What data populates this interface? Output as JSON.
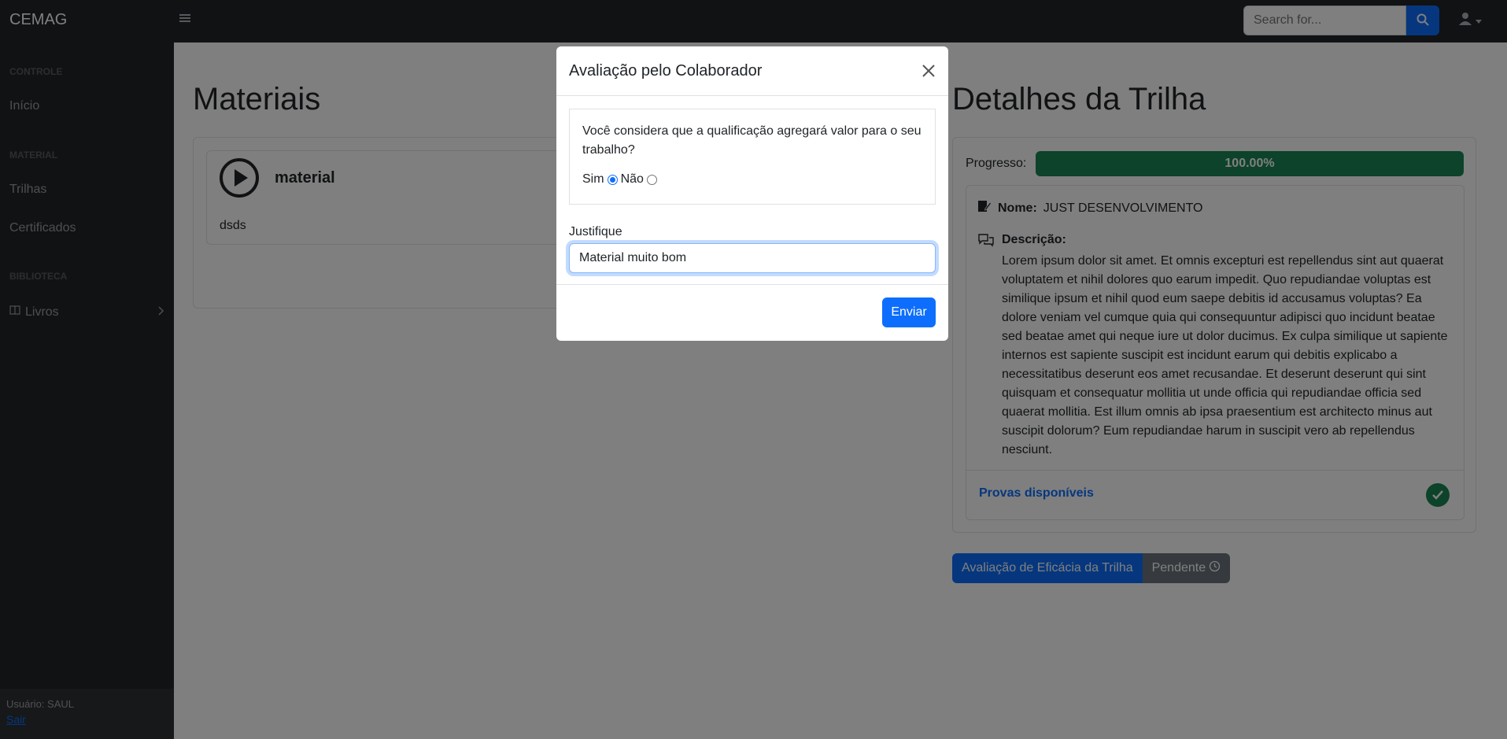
{
  "navbar": {
    "brand": "CEMAG",
    "search_placeholder": "Search for..."
  },
  "sidebar": {
    "sections": [
      {
        "heading": "CONTROLE",
        "items": [
          {
            "label": "Início"
          }
        ]
      },
      {
        "heading": "MATERIAL",
        "items": [
          {
            "label": "Trilhas"
          },
          {
            "label": "Certificados"
          }
        ]
      },
      {
        "heading": "BIBLIOTECA",
        "items": [
          {
            "label": "Livros"
          }
        ]
      }
    ],
    "footer": {
      "user_text": "Usuário: SAUL",
      "logout_label": "Sair"
    }
  },
  "materials": {
    "title": "Materiais",
    "items": [
      {
        "title": "material",
        "description": "dsds"
      }
    ]
  },
  "trilha": {
    "title": "Detalhes da Trilha",
    "progress_label": "Progresso:",
    "progress_value": 100,
    "progress_text": "100.00%",
    "name_label": "Nome:",
    "name_value": "JUST DESENVOLVIMENTO",
    "description_label": "Descrição:",
    "description_text": "Lorem ipsum dolor sit amet. Et omnis excepturi est repellendus sint aut quaerat voluptatem et nihil dolores quo earum impedit. Quo repudiandae voluptas est similique ipsum et nihil quod eum saepe debitis id accusamus voluptas? Ea dolore veniam vel cumque quia qui consequuntur adipisci quo incidunt beatae sed beatae amet qui neque iure ut dolor ducimus. Ex culpa similique ut sapiente internos est sapiente suscipit est incidunt earum qui debitis explicabo a necessitatibus deserunt eos amet recusandae. Et deserunt deserunt qui sint quisquam et consequatur mollitia ut unde officia qui repudiandae officia sed quaerat mollitia. Est illum omnis ab ipsa praesentium est architecto minus aut suscipit dolorum? Eum repudiandae harum in suscipit vero ab repellendus nesciunt.",
    "provas_label": "Provas disponíveis",
    "eval_button": "Avaliação de Eficácia da Trilha",
    "status_label": "Pendente"
  },
  "modal": {
    "title": "Avaliação pelo Colaborador",
    "question": "Você considera que a qualificação agregará valor para o seu trabalho?",
    "option_yes": "Sim",
    "option_no": "Não",
    "selected": "Sim",
    "justify_label": "Justifique",
    "justify_value": "Material muito bom",
    "submit_label": "Enviar"
  },
  "colors": {
    "primary": "#0d6efd",
    "success": "#198754",
    "dark": "#212529",
    "secondary": "#6c757d"
  }
}
